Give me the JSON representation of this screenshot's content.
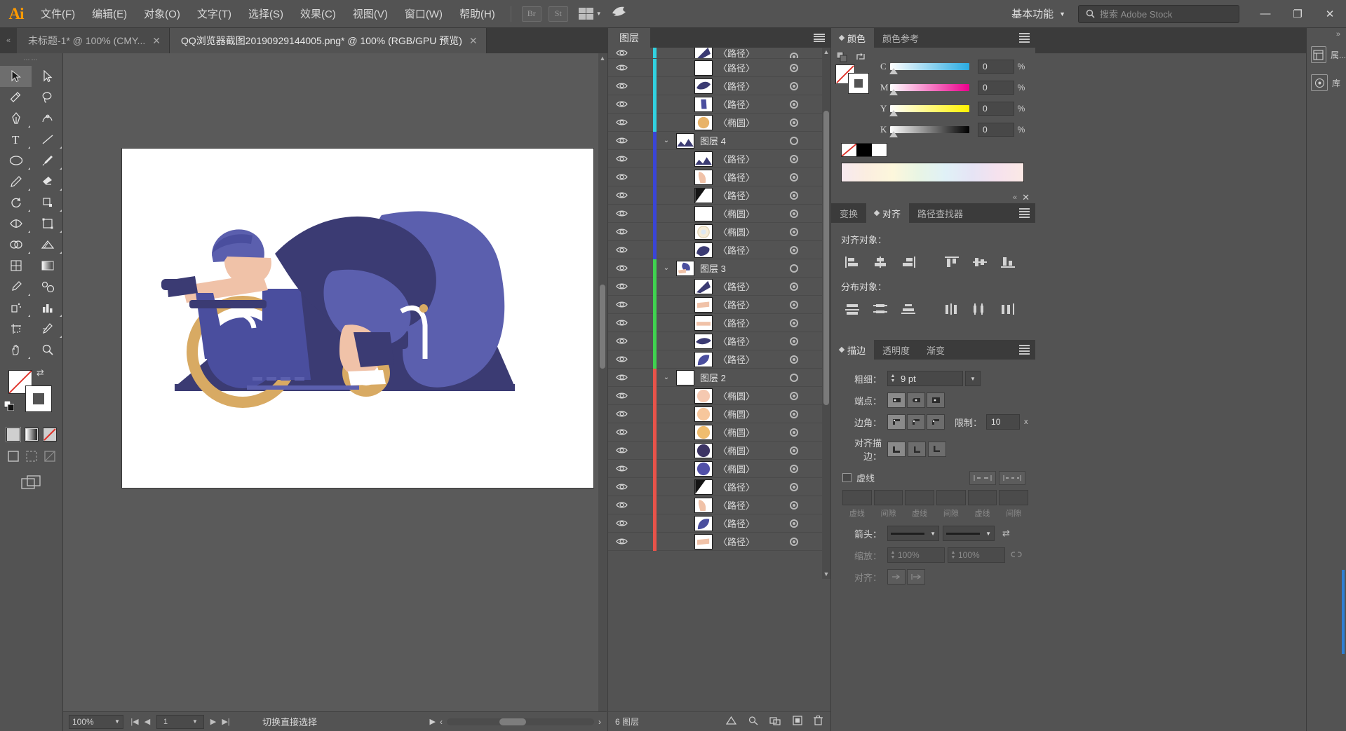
{
  "app": {
    "logo": "Ai",
    "menus": [
      "文件(F)",
      "编辑(E)",
      "对象(O)",
      "文字(T)",
      "选择(S)",
      "效果(C)",
      "视图(V)",
      "窗口(W)",
      "帮助(H)"
    ],
    "bridge_label": "Br",
    "stock_label": "St",
    "workspace": "基本功能",
    "search_placeholder": "搜索 Adobe Stock",
    "window_minimize": "—",
    "window_restore": "❐",
    "window_close": "✕"
  },
  "tabs": [
    {
      "title": "未标题-1* @ 100% (CMY...",
      "close": "✕",
      "active": false
    },
    {
      "title": "QQ浏览器截图20190929144005.png* @ 100% (RGB/GPU 预览)",
      "close": "✕",
      "active": true
    }
  ],
  "toolbar": {
    "title": "工具",
    "tools": [
      "selection-tool",
      "direct-selection-tool",
      "magic-wand-tool",
      "lasso-tool",
      "pen-tool",
      "curvature-tool",
      "type-tool",
      "line-segment-tool",
      "ellipse-tool",
      "paintbrush-tool",
      "pencil-tool",
      "eraser-tool",
      "rotate-tool",
      "scale-tool",
      "width-tool",
      "free-transform-tool",
      "shape-builder-tool",
      "perspective-grid-tool",
      "mesh-tool",
      "gradient-tool",
      "eyedropper-tool",
      "blend-tool",
      "symbol-sprayer-tool",
      "column-graph-tool",
      "artboard-tool",
      "slice-tool",
      "hand-tool",
      "zoom-tool"
    ],
    "fill_stroke": {
      "fill": "#ffffff",
      "stroke": "#ffffff"
    },
    "modes": [
      "normal-screen-mode",
      "full-screen-mode",
      "none-mode"
    ]
  },
  "canvas": {
    "background": "#5a5a5a",
    "artboard_background": "#ffffff",
    "illustration_colors": {
      "dark_navy": "#3b3b73",
      "blue": "#5b5fae",
      "mid_blue": "#4a4e9e",
      "skin": "#f0c2a8",
      "tan": "#d8aa63",
      "white": "#ffffff"
    }
  },
  "statusbar": {
    "zoom": "100%",
    "page": "1",
    "tool_status": "切换直接选择",
    "nav_first": "|◀",
    "nav_prev": "◀",
    "nav_next": "▶",
    "nav_last": "▶|",
    "play": "▶",
    "scroll_left": "‹",
    "scroll_right": "›"
  },
  "layers_panel": {
    "tab": "图层",
    "footer_count": "6 图层",
    "footer_icons": [
      "make-clipping-mask-icon",
      "create-new-sublayer-icon",
      "locate-object-icon",
      "create-new-layer-icon",
      "delete-selection-icon"
    ],
    "rows": [
      {
        "name": "〈路径〉",
        "type": "path",
        "color": "#31d2e0",
        "indent": "child",
        "thumb": "navy-wedge",
        "partial": true
      },
      {
        "name": "〈路径〉",
        "type": "path",
        "color": "#31d2e0",
        "indent": "child",
        "thumb": "white"
      },
      {
        "name": "〈路径〉",
        "type": "path",
        "color": "#31d2e0",
        "indent": "child",
        "thumb": "navy-leaf"
      },
      {
        "name": "〈路径〉",
        "type": "path",
        "color": "#31d2e0",
        "indent": "child",
        "thumb": "blue-tag"
      },
      {
        "name": "〈椭圆〉",
        "type": "ellipse",
        "color": "#31d2e0",
        "indent": "child",
        "thumb": "tan-circle"
      },
      {
        "name": "图层 4",
        "type": "layer",
        "color": "#3a45d8",
        "indent": "group",
        "thumb": "navy-scene"
      },
      {
        "name": "〈路径〉",
        "type": "path",
        "color": "#3a45d8",
        "indent": "child",
        "thumb": "navy-scene"
      },
      {
        "name": "〈路径〉",
        "type": "path",
        "color": "#3a45d8",
        "indent": "child",
        "thumb": "skin-shape"
      },
      {
        "name": "〈路径〉",
        "type": "path",
        "color": "#3a45d8",
        "indent": "child",
        "thumb": "black-tri"
      },
      {
        "name": "〈椭圆〉",
        "type": "ellipse",
        "color": "#3a45d8",
        "indent": "child",
        "thumb": "white"
      },
      {
        "name": "〈椭圆〉",
        "type": "ellipse",
        "color": "#3a45d8",
        "indent": "child",
        "thumb": "cream-ring"
      },
      {
        "name": "〈路径〉",
        "type": "path",
        "color": "#3a45d8",
        "indent": "child",
        "thumb": "navy-blob"
      },
      {
        "name": "图层 3",
        "type": "layer",
        "color": "#3fd34f",
        "indent": "group",
        "thumb": "navy-hand"
      },
      {
        "name": "〈路径〉",
        "type": "path",
        "color": "#3fd34f",
        "indent": "child",
        "thumb": "navy-wedge"
      },
      {
        "name": "〈路径〉",
        "type": "path",
        "color": "#3fd34f",
        "indent": "child",
        "thumb": "skin-arm"
      },
      {
        "name": "〈路径〉",
        "type": "path",
        "color": "#3fd34f",
        "indent": "child",
        "thumb": "skin-bar"
      },
      {
        "name": "〈路径〉",
        "type": "path",
        "color": "#3fd34f",
        "indent": "child",
        "thumb": "navy-dart"
      },
      {
        "name": "〈路径〉",
        "type": "path",
        "color": "#3fd34f",
        "indent": "child",
        "thumb": "blue-wing"
      },
      {
        "name": "图层 2",
        "type": "layer",
        "color": "#e8534a",
        "indent": "group",
        "thumb": "white"
      },
      {
        "name": "〈椭圆〉",
        "type": "ellipse",
        "color": "#e8534a",
        "indent": "child",
        "thumb": "skin-circle"
      },
      {
        "name": "〈椭圆〉",
        "type": "ellipse",
        "color": "#e8534a",
        "indent": "child",
        "thumb": "peach-circle"
      },
      {
        "name": "〈椭圆〉",
        "type": "ellipse",
        "color": "#e8534a",
        "indent": "child",
        "thumb": "tan-circle2"
      },
      {
        "name": "〈椭圆〉",
        "type": "ellipse",
        "color": "#e8534a",
        "indent": "child",
        "thumb": "dark-circle"
      },
      {
        "name": "〈椭圆〉",
        "type": "ellipse",
        "color": "#e8534a",
        "indent": "child",
        "thumb": "blue-circle"
      },
      {
        "name": "〈路径〉",
        "type": "path",
        "color": "#e8534a",
        "indent": "child",
        "thumb": "black-tri"
      },
      {
        "name": "〈路径〉",
        "type": "path",
        "color": "#e8534a",
        "indent": "child",
        "thumb": "skin-shape"
      },
      {
        "name": "〈路径〉",
        "type": "path",
        "color": "#e8534a",
        "indent": "child",
        "thumb": "blue-wing"
      },
      {
        "name": "〈路径〉",
        "type": "path",
        "color": "#e8534a",
        "indent": "child",
        "thumb": "skin-arm"
      }
    ]
  },
  "color_panel": {
    "tabs": [
      "颜色",
      "颜色参考"
    ],
    "active_tab": "颜色",
    "sliders": [
      {
        "label": "C",
        "value": "0",
        "unit": "%",
        "color": "#29abe2"
      },
      {
        "label": "M",
        "value": "0",
        "unit": "%",
        "color": "#ec008c"
      },
      {
        "label": "Y",
        "value": "0",
        "unit": "%",
        "color": "#fff200"
      },
      {
        "label": "K",
        "value": "0",
        "unit": "%",
        "color": "#000000"
      }
    ]
  },
  "align_panel": {
    "tabs": [
      "变换",
      "对齐",
      "路径查找器"
    ],
    "active_tab": "对齐",
    "align_objects_label": "对齐对象：",
    "distribute_objects_label": "分布对象：",
    "align_buttons": [
      "align-left-icon",
      "align-horizontal-center-icon",
      "align-right-icon",
      "align-top-icon",
      "align-vertical-center-icon",
      "align-bottom-icon"
    ],
    "distribute_buttons": [
      "distribute-top-icon",
      "distribute-vertical-center-icon",
      "distribute-bottom-icon",
      "distribute-left-icon",
      "distribute-horizontal-center-icon",
      "distribute-right-icon"
    ]
  },
  "stroke_panel": {
    "tabs": [
      "描边",
      "透明度",
      "渐变"
    ],
    "active_tab": "描边",
    "weight_label": "粗细：",
    "weight_value": "9 pt",
    "cap_label": "端点：",
    "corner_label": "边角：",
    "limit_label": "限制：",
    "limit_value": "10",
    "limit_unit": "x",
    "align_stroke_label": "对齐描边：",
    "dashed_label": "虚线",
    "dash_fields": [
      "虚线",
      "间隙",
      "虚线",
      "间隙",
      "虚线",
      "间隙"
    ],
    "arrows_label": "箭头：",
    "scale_label": "缩放：",
    "scale_value_1": "100%",
    "scale_value_2": "100%",
    "align_label": "对齐："
  },
  "far_dock": {
    "items": [
      {
        "label": "属...",
        "icon": "properties-icon"
      },
      {
        "label": "库",
        "icon": "libraries-icon"
      }
    ]
  }
}
